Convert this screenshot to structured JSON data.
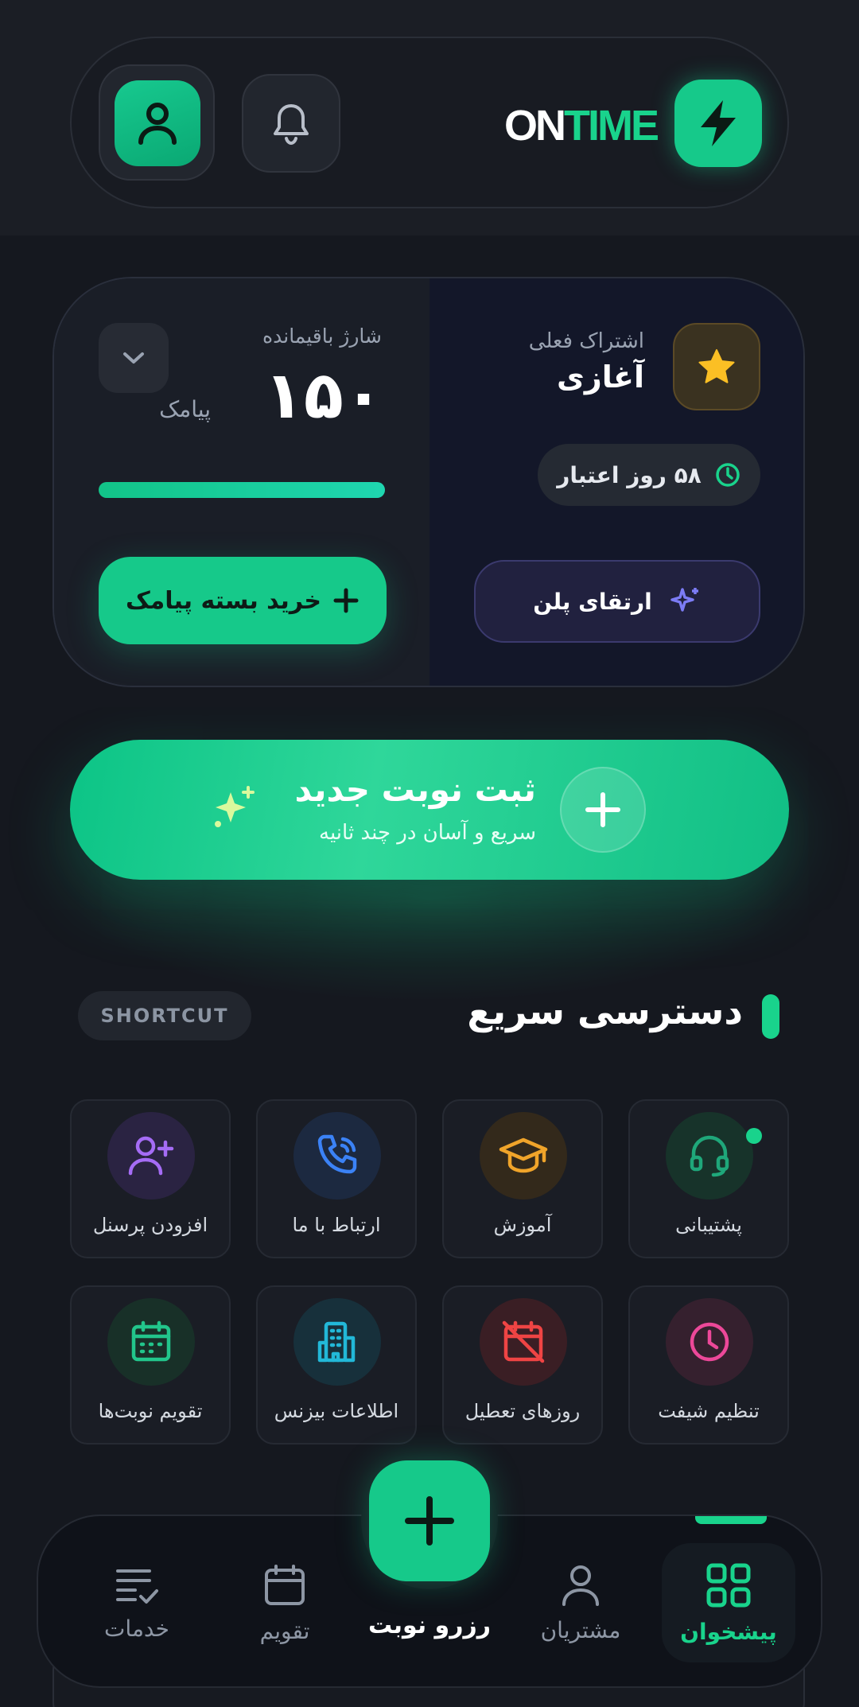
{
  "header": {
    "logo_on": "ON",
    "logo_time": "TIME",
    "icons": {
      "logo": "lightning-icon",
      "bell": "bell-icon",
      "avatar": "user-icon"
    }
  },
  "subscription": {
    "balance_label": "شارژ باقیمانده",
    "balance_value": "۱۵۰",
    "balance_unit": "پیامک",
    "balance_progress_pct": 100,
    "buy_label": "خرید بسته پیامک",
    "plan_label": "اشتراک فعلی",
    "plan_name": "آغازی",
    "days_label": "۵۸ روز اعتبار",
    "upgrade_label": "ارتقای پلن"
  },
  "cta": {
    "title": "ثبت نوبت جدید",
    "subtitle": "سریع و آسان در چند ثانیه"
  },
  "section": {
    "title": "دسترسی سریع",
    "chip": "SHORTCUT"
  },
  "shortcuts": [
    {
      "label": "پشتیبانی",
      "icon": "headset-icon",
      "color": "#1fa77a"
    },
    {
      "label": "آموزش",
      "icon": "graduation-cap-icon",
      "color": "#f0a42a"
    },
    {
      "label": "ارتباط با ما",
      "icon": "phone-icon",
      "color": "#3b82f6"
    },
    {
      "label": "افزودن پرسنل",
      "icon": "add-user-icon",
      "color": "#a56cf5"
    },
    {
      "label": "تنظیم شیفت",
      "icon": "clock-icon",
      "color": "#ec4899"
    },
    {
      "label": "روزهای تعطیل",
      "icon": "calendar-off-icon",
      "color": "#ef4444"
    },
    {
      "label": "اطلاعات بیزنس",
      "icon": "building-icon",
      "color": "#22b8d8"
    },
    {
      "label": "تقویم نوبت‌ها",
      "icon": "calendar-icon",
      "color": "#22c58b"
    }
  ],
  "nav": {
    "dashboard": "پیشخوان",
    "customers": "مشتریان",
    "book": "رزرو نوبت",
    "calendar": "تقویم",
    "services": "خدمات"
  },
  "colors": {
    "accent": "#16c98a",
    "background": "#15181f"
  }
}
